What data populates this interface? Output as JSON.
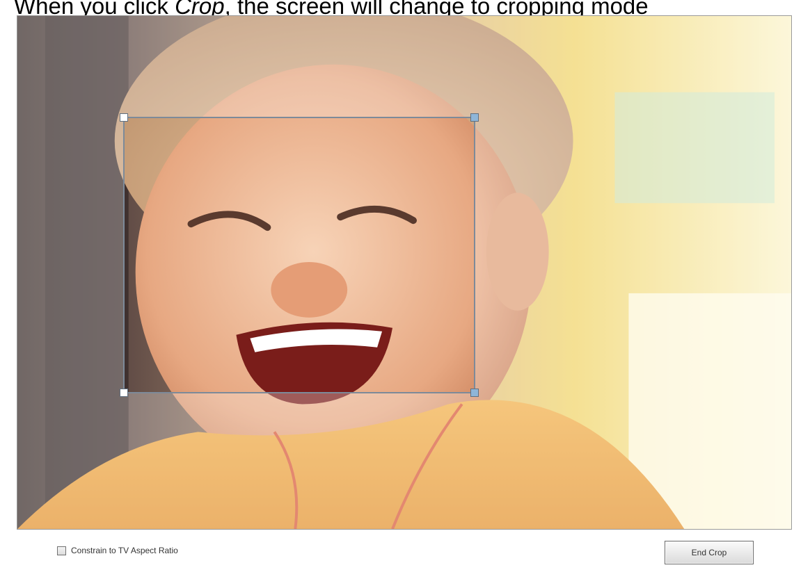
{
  "caption": {
    "prefix": "When you click ",
    "emphasis": "Crop",
    "suffix": ", the screen will change to cropping mode"
  },
  "editor": {
    "photo_subject": "smiling-child-photo",
    "crop_handle_colors": {
      "white": "#ffffff",
      "blue": "#8fb6d8"
    }
  },
  "controls": {
    "constrain_label": "Constrain to TV Aspect Ratio",
    "constrain_checked": false,
    "end_crop_label": "End Crop"
  }
}
